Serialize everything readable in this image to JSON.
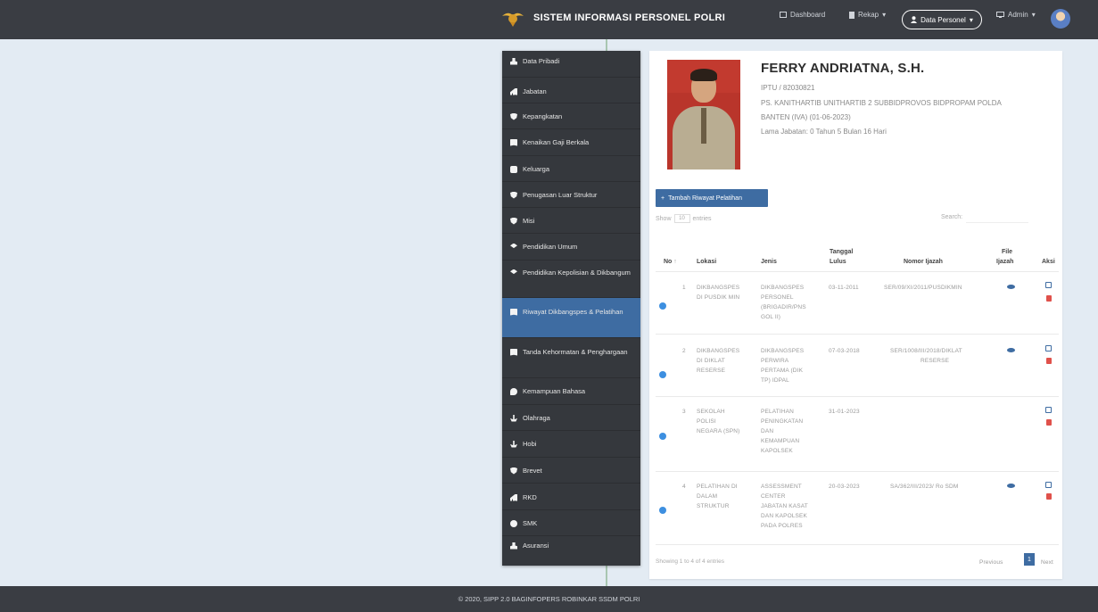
{
  "app_title": "SISTEM INFORMASI PERSONEL POLRI",
  "nav": {
    "dashboard": "Dashboard",
    "rekap": "Rekap",
    "data_personel": "Data Personel",
    "admin": "Admin"
  },
  "sidebar": {
    "items": [
      {
        "label": "Data Pribadi",
        "icon": "user-icon"
      },
      {
        "label": "Jabatan",
        "icon": "bar-chart-icon"
      },
      {
        "label": "Kepangkatan",
        "icon": "shield-icon"
      },
      {
        "label": "Kenaikan Gaji Berkala",
        "icon": "book-icon"
      },
      {
        "label": "Keluarga",
        "icon": "users-icon"
      },
      {
        "label": "Penugasan Luar Struktur",
        "icon": "shield-icon"
      },
      {
        "label": "Misi",
        "icon": "shield-icon"
      },
      {
        "label": "Pendidikan Umum",
        "icon": "graduation-cap-icon"
      },
      {
        "label": "Pendidikan Kepolisian & Dikbangum",
        "icon": "graduation-cap-icon"
      },
      {
        "label": "Riwayat Dikbangspes & Pelatihan",
        "icon": "book-icon",
        "active": true
      },
      {
        "label": "Tanda Kehormatan & Penghargaan",
        "icon": "book-icon"
      },
      {
        "label": "Kemampuan Bahasa",
        "icon": "chat-icon"
      },
      {
        "label": "Olahraga",
        "icon": "anchor-icon"
      },
      {
        "label": "Hobi",
        "icon": "anchor-icon"
      },
      {
        "label": "Brevet",
        "icon": "shield-icon"
      },
      {
        "label": "RKD",
        "icon": "bar-chart-icon"
      },
      {
        "label": "SMK",
        "icon": "circle-icon"
      },
      {
        "label": "Asuransi",
        "icon": "user-icon"
      }
    ]
  },
  "profile": {
    "name": "FERRY ANDRIATNA, S.H.",
    "rank_nrp": "IPTU / 82030821",
    "position_line1": "PS. KANITHARTIB UNITHARTIB 2 SUBBIDPROVOS BIDPROPAM POLDA",
    "position_line2": "BANTEN (IVA) (01-06-2023)",
    "tenure": "Lama Jabatan: 0 Tahun 5 Bulan 16 Hari"
  },
  "table": {
    "add_button": "Tambah Riwayat Pelatihan",
    "show_label": "Show",
    "show_value": "10",
    "entries_label": "entries",
    "search_label": "Search:",
    "headers": {
      "no": "No",
      "lokasi": "Lokasi",
      "jenis": "Jenis",
      "tanggal_line1": "Tanggal",
      "tanggal_line2": "Lulus",
      "nomor_ijazah": "Nomor Ijazah",
      "file_line1": "File",
      "file_line2": "Ijazah",
      "aksi": "Aksi"
    },
    "rows": [
      {
        "no": "1",
        "lokasi": [
          "DIKBANGSPES",
          "DI PUSDIK MIN"
        ],
        "jenis": [
          "DIKBANGSPES",
          "PERSONEL",
          "(BRIGADIR/PNS",
          "GOL II)"
        ],
        "tanggal": "03-11-2011",
        "nomor": "SER/09/XI/2011/PUSDIKMIN"
      },
      {
        "no": "2",
        "lokasi": [
          "DIKBANGSPES",
          "DI DIKLAT",
          "RESERSE"
        ],
        "jenis": [
          "DIKBANGSPES",
          "PERWIRA",
          "PERTAMA (DIK",
          "TP) IDPAL"
        ],
        "tanggal": "07-03-2018",
        "nomor": [
          "SER/1008/III/2018/DIKLAT",
          "RESERSE"
        ]
      },
      {
        "no": "3",
        "lokasi": [
          "SEKOLAH",
          "POLISI",
          "NEGARA (SPN)"
        ],
        "jenis": [
          "PELATIHAN",
          "PENINGKATAN",
          "DAN",
          "KEMAMPUAN",
          "KAPOLSEK"
        ],
        "tanggal": "31-01-2023",
        "nomor": ""
      },
      {
        "no": "4",
        "lokasi": [
          "PELATIHAN DI",
          "DALAM",
          "STRUKTUR"
        ],
        "jenis": [
          "ASSESSMENT",
          "CENTER",
          "JABATAN KASAT",
          "DAN KAPOLSEK",
          "PADA POLRES"
        ],
        "tanggal": "20-03-2023",
        "nomor": "SA/362/III/2023/ Ro SDM"
      }
    ],
    "info": "Showing 1 to 4 of 4 entries",
    "prev": "Previous",
    "page": "1",
    "next": "Next"
  },
  "footer": "© 2020, SIPP 2.0 BAGINFOPERS ROBINKAR SSDM POLRI",
  "colors": {
    "topbar": "#3a3d43",
    "sidebar": "#35383d",
    "active": "#3e6ca2",
    "background": "#e3ebf3"
  }
}
